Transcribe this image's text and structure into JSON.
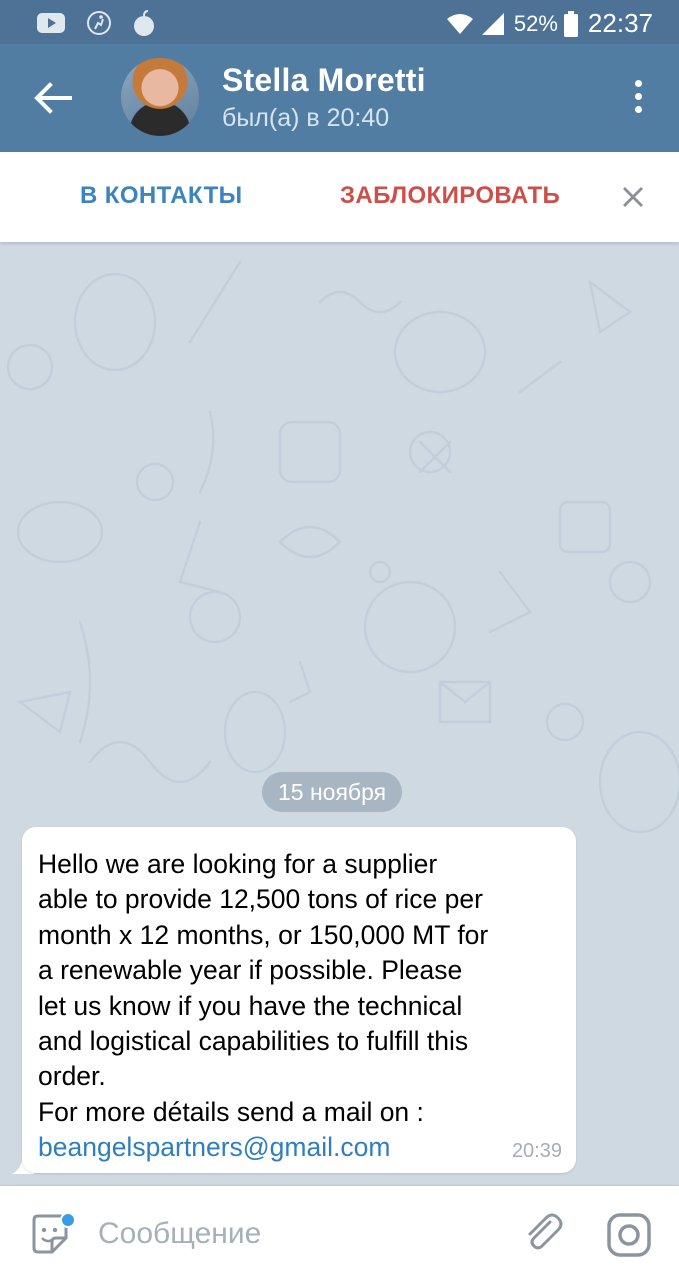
{
  "status_bar": {
    "battery_percent": "52%",
    "time": "22:37",
    "icons": [
      "youtube-icon",
      "activity-icon",
      "bomb-icon",
      "wifi-icon",
      "signal-icon",
      "battery-icon"
    ]
  },
  "header": {
    "name": "Stella Moretti",
    "status": "был(а) в 20:40"
  },
  "action_bar": {
    "add_contact": "В КОНТАКТЫ",
    "block": "ЗАБЛОКИРОВАТЬ"
  },
  "chat": {
    "date": "15 ноября",
    "message": {
      "lines": [
        "Hello we are looking for a supplier",
        "able to provide 12,500 tons of rice per",
        "month x 12 months, or 150,000 MT for",
        "a renewable year if possible.  Please",
        "let us know if you have the technical",
        "and logistical capabilities to fulfill this",
        "order.",
        "For more détails send a mail on :"
      ],
      "link": "beangelspartners@gmail.com",
      "time": "20:39"
    }
  },
  "input": {
    "placeholder": "Сообщение"
  },
  "colors": {
    "status_bar": "#4e7296",
    "header": "#517da2",
    "chat_background": "#cfd9e2",
    "add_contact": "#3b84c0",
    "block": "#cc5049",
    "link": "#2f7fbd",
    "emoji_badge": "#3a9ce6"
  }
}
